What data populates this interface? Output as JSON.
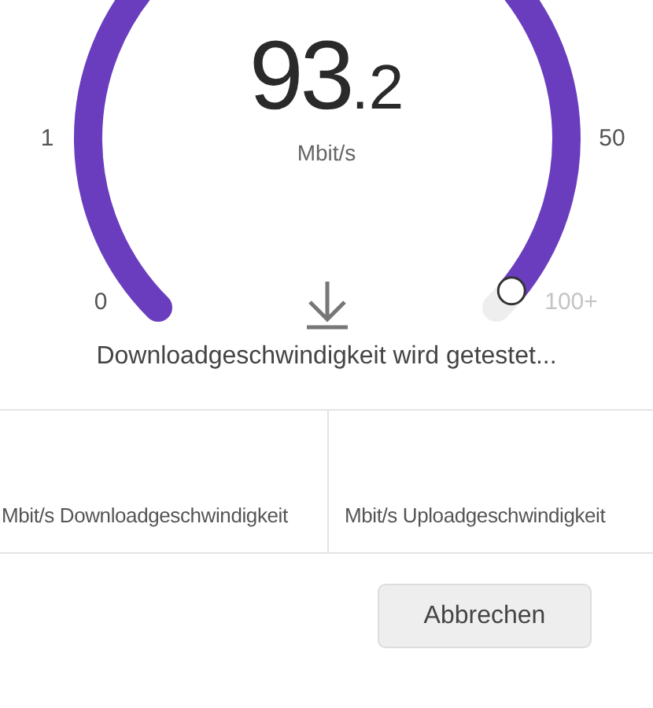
{
  "gauge": {
    "value": "93",
    "value_decimal": ".2",
    "unit": "Mbit/s",
    "scale_labels": [
      {
        "text": "1",
        "reached": true
      },
      {
        "text": "50",
        "reached": true
      },
      {
        "text": "0",
        "reached": true
      },
      {
        "text": "100+",
        "reached": false
      }
    ]
  },
  "status": "Downloadgeschwindigkeit wird getestet...",
  "results": [
    {
      "label": "Mbit/s Downloadgeschwindigkeit"
    },
    {
      "label": "Mbit/s Uploadgeschwindigkeit"
    }
  ],
  "buttons": [
    "Abbrechen"
  ]
}
